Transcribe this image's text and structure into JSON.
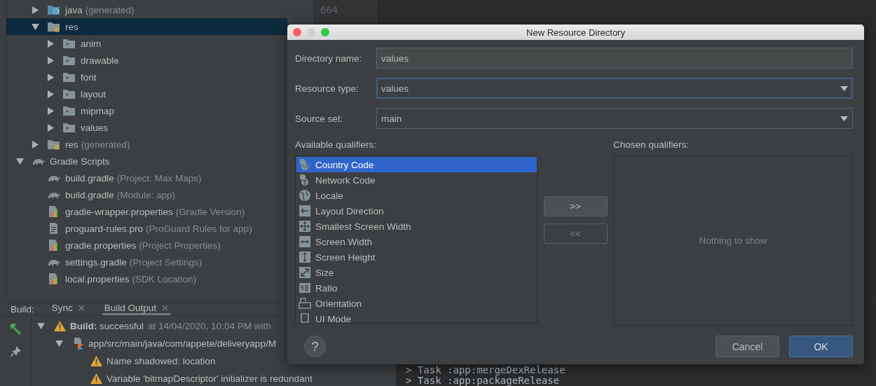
{
  "project_tree": {
    "module_items": [
      {
        "name": "java",
        "note": "(generated)",
        "kind": "java-folder",
        "expanded": false,
        "selected": false
      },
      {
        "name": "res",
        "kind": "res-folder",
        "expanded": true,
        "selected": true,
        "children": [
          {
            "name": "anim",
            "kind": "folder",
            "expanded": false,
            "selected": false
          },
          {
            "name": "drawable",
            "kind": "folder",
            "expanded": false,
            "selected": false
          },
          {
            "name": "font",
            "kind": "folder",
            "expanded": false,
            "selected": false
          },
          {
            "name": "layout",
            "kind": "folder",
            "expanded": false,
            "selected": false
          },
          {
            "name": "mipmap",
            "kind": "folder",
            "expanded": false,
            "selected": false
          },
          {
            "name": "values",
            "kind": "folder",
            "expanded": false,
            "selected": false
          }
        ]
      },
      {
        "name": "res",
        "note": "(generated)",
        "kind": "res-folder",
        "expanded": false,
        "selected": false
      }
    ],
    "root_items": [
      {
        "name": "Gradle Scripts",
        "kind": "gradle",
        "expanded": true,
        "selected": false,
        "children": [
          {
            "name": "build.gradle",
            "note": "(Project: Max Maps)",
            "kind": "gradle",
            "selected": false
          },
          {
            "name": "build.gradle",
            "note": "(Module: app)",
            "kind": "gradle",
            "selected": false
          },
          {
            "name": "gradle-wrapper.properties",
            "note": "(Gradle Version)",
            "kind": "properties",
            "selected": false
          },
          {
            "name": "proguard-rules.pro",
            "note": "(ProGuard Rules for app)",
            "kind": "text",
            "selected": false
          },
          {
            "name": "gradle.properties",
            "note": "(Project Properties)",
            "kind": "properties",
            "selected": false
          },
          {
            "name": "settings.gradle",
            "note": "(Project Settings)",
            "kind": "gradle",
            "selected": false
          },
          {
            "name": "local.properties",
            "note": "(SDK Location)",
            "kind": "properties",
            "selected": false
          }
        ]
      }
    ]
  },
  "editor": {
    "line_number": "664",
    "console_lines": [
      "> Task :app:mergeDexRelease",
      "> Task :app:packageRelease"
    ]
  },
  "build_panel": {
    "label": "Build:",
    "tabs": [
      {
        "label": "Sync",
        "selected": false
      },
      {
        "label": "Build Output",
        "selected": true
      }
    ],
    "output": [
      {
        "kind": "summary",
        "text": "**Build:** successful",
        "note": "at 14/04/2020, 10:04 PM with",
        "expanded": true,
        "children": [
          {
            "kind": "file",
            "text": "app/src/main/java/com/appete/deliveryapp/M",
            "expanded": true,
            "children": [
              {
                "kind": "warning",
                "text": "Name shadowed: location"
              },
              {
                "kind": "warning",
                "text": "Variable 'bitmapDescriptor' initializer is redundant"
              }
            ]
          }
        ]
      }
    ]
  },
  "dialog": {
    "title": "New Resource Directory",
    "fields": [
      {
        "label": "Directory name:",
        "kind": "text",
        "value": "values",
        "focused": false
      },
      {
        "label": "Resource type:",
        "kind": "dropdown",
        "value": "values",
        "focused": true
      },
      {
        "label": "Source set:",
        "kind": "dropdown",
        "value": "main",
        "focused": false
      }
    ],
    "available_label": "Available qualifiers:",
    "qualifiers": [
      {
        "label": "Country Code",
        "kind": "country",
        "selected": true
      },
      {
        "label": "Network Code",
        "kind": "network",
        "selected": false
      },
      {
        "label": "Locale",
        "kind": "locale",
        "selected": false
      },
      {
        "label": "Layout Direction",
        "kind": "direction",
        "selected": false
      },
      {
        "label": "Smallest Screen Width",
        "kind": "smallest",
        "selected": false
      },
      {
        "label": "Screen Width",
        "kind": "width",
        "selected": false
      },
      {
        "label": "Screen Height",
        "kind": "height",
        "selected": false
      },
      {
        "label": "Size",
        "kind": "size",
        "selected": false
      },
      {
        "label": "Ratio",
        "kind": "ratio",
        "selected": false
      },
      {
        "label": "Orientation",
        "kind": "orientation",
        "selected": false
      },
      {
        "label": "UI Mode",
        "kind": "uimode",
        "selected": false
      }
    ],
    "chosen_label": "Chosen qualifiers:",
    "chosen_empty": "Nothing to show",
    "add_button": {
      "label": ">>",
      "disabled": false
    },
    "remove_button": {
      "label": "<<",
      "disabled": true
    },
    "help": "?",
    "buttons": [
      {
        "label": "Cancel",
        "default": false
      },
      {
        "label": "OK",
        "default": true
      }
    ]
  }
}
